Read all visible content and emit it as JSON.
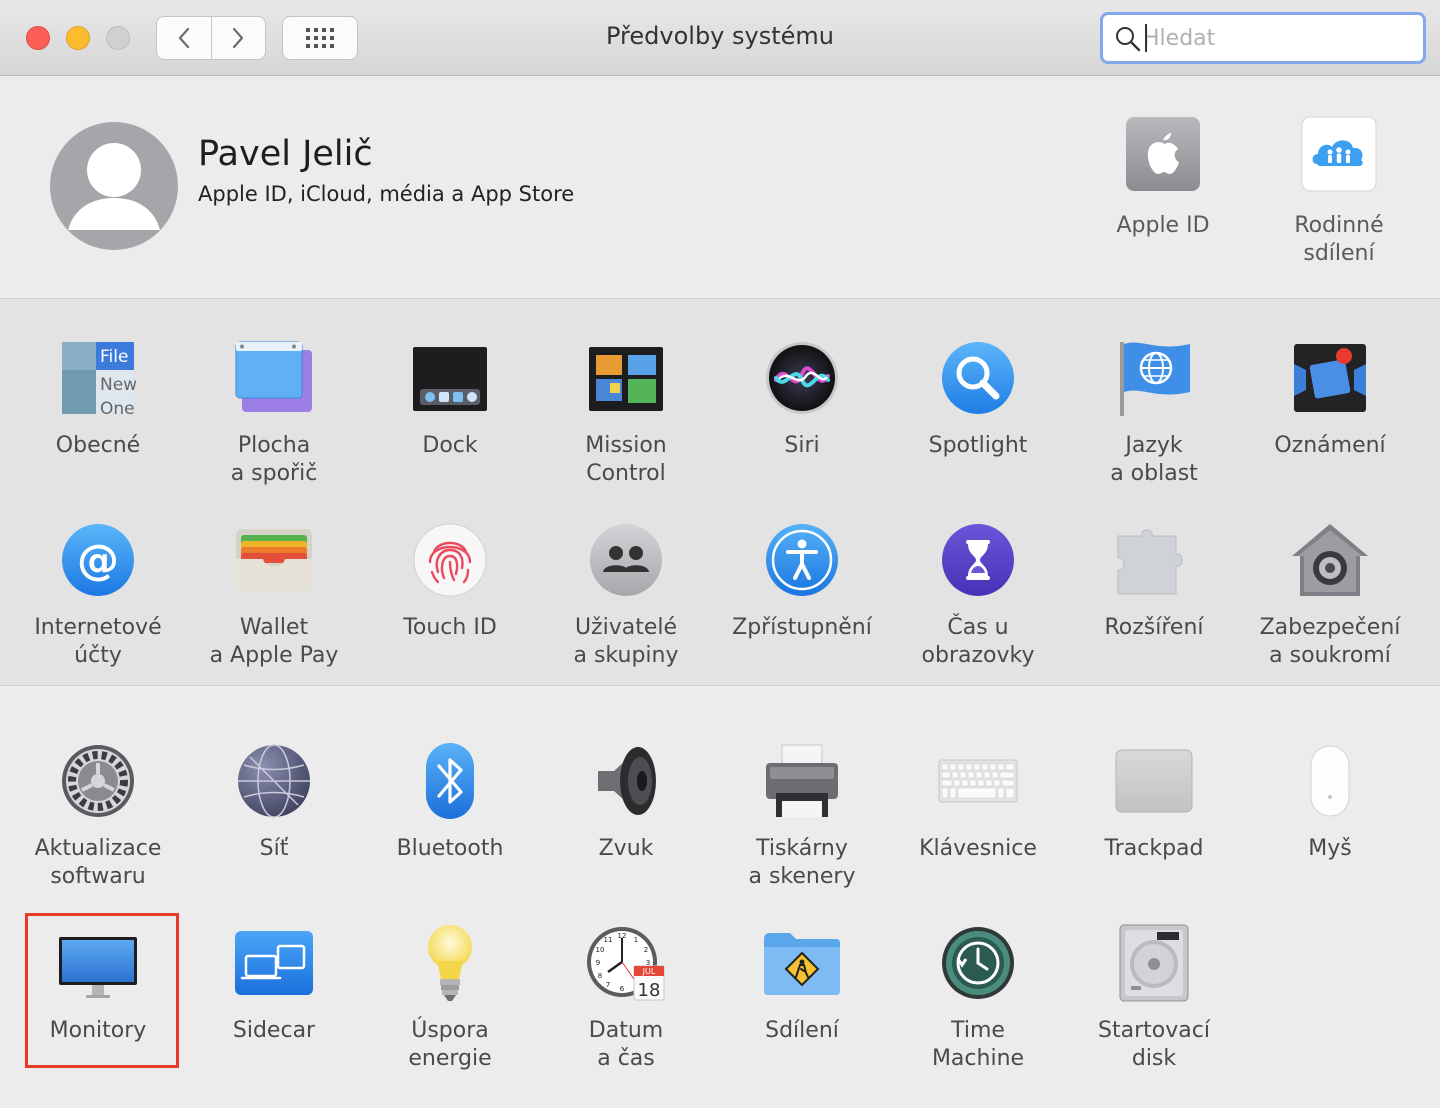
{
  "window": {
    "title": "Předvolby systému",
    "search_placeholder": "Hledat"
  },
  "account": {
    "name": "Pavel Jelič",
    "subtitle": "Apple ID, iCloud, média a App Store",
    "items": [
      {
        "label": "Apple ID",
        "icon": "apple-logo-icon"
      },
      {
        "label": "Rodinné\nsdílení",
        "icon": "family-sharing-icon"
      }
    ]
  },
  "panes_row1": [
    {
      "label": "Obecné",
      "icon": "general-icon"
    },
    {
      "label": "Plocha\na spořič",
      "icon": "desktop-screensaver-icon"
    },
    {
      "label": "Dock",
      "icon": "dock-icon"
    },
    {
      "label": "Mission\nControl",
      "icon": "mission-control-icon"
    },
    {
      "label": "Siri",
      "icon": "siri-icon"
    },
    {
      "label": "Spotlight",
      "icon": "spotlight-icon"
    },
    {
      "label": "Jazyk\na oblast",
      "icon": "language-region-icon"
    },
    {
      "label": "Oznámení",
      "icon": "notifications-icon"
    }
  ],
  "panes_row2": [
    {
      "label": "Internetové\núčty",
      "icon": "internet-accounts-icon"
    },
    {
      "label": "Wallet\na Apple Pay",
      "icon": "wallet-icon"
    },
    {
      "label": "Touch ID",
      "icon": "touch-id-icon"
    },
    {
      "label": "Uživatelé\na skupiny",
      "icon": "users-groups-icon"
    },
    {
      "label": "Zpřístupnění",
      "icon": "accessibility-icon"
    },
    {
      "label": "Čas u obrazovky",
      "icon": "screen-time-icon"
    },
    {
      "label": "Rozšíření",
      "icon": "extensions-icon"
    },
    {
      "label": "Zabezpečení\na soukromí",
      "icon": "security-privacy-icon"
    }
  ],
  "panes_row3": [
    {
      "label": "Aktualizace\nsoftwaru",
      "icon": "software-update-icon"
    },
    {
      "label": "Síť",
      "icon": "network-icon"
    },
    {
      "label": "Bluetooth",
      "icon": "bluetooth-icon"
    },
    {
      "label": "Zvuk",
      "icon": "sound-icon"
    },
    {
      "label": "Tiskárny\na skenery",
      "icon": "printers-scanners-icon"
    },
    {
      "label": "Klávesnice",
      "icon": "keyboard-icon"
    },
    {
      "label": "Trackpad",
      "icon": "trackpad-icon"
    },
    {
      "label": "Myš",
      "icon": "mouse-icon"
    }
  ],
  "panes_row4": [
    {
      "label": "Monitory",
      "icon": "displays-icon"
    },
    {
      "label": "Sidecar",
      "icon": "sidecar-icon"
    },
    {
      "label": "Úspora\nenergie",
      "icon": "energy-saver-icon"
    },
    {
      "label": "Datum\na čas",
      "icon": "date-time-icon"
    },
    {
      "label": "Sdílení",
      "icon": "sharing-icon"
    },
    {
      "label": "Time\nMachine",
      "icon": "time-machine-icon"
    },
    {
      "label": "Startovací\ndisk",
      "icon": "startup-disk-icon"
    }
  ],
  "icon_texts": {
    "general_file": "File",
    "general_new": "New",
    "general_one": "One",
    "calendar_month": "JUL",
    "calendar_day": "18"
  },
  "colors": {
    "highlight": "#e8392a",
    "search_focus": "#84a8e9",
    "close": "#fc5f57",
    "minimize": "#fdbc2e"
  }
}
